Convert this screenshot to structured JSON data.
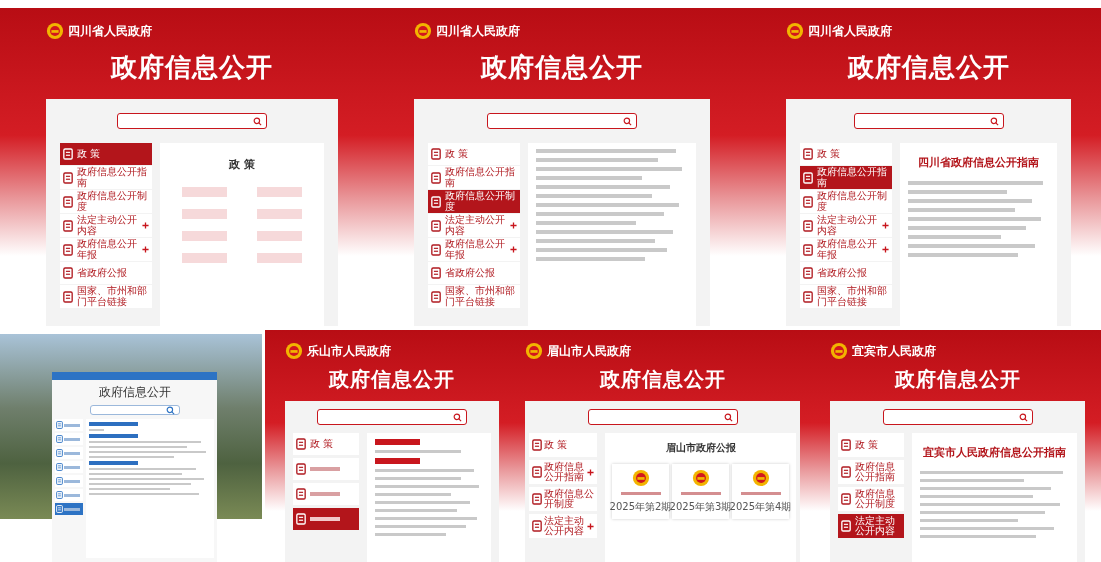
{
  "panels": [
    {
      "kind": "red",
      "logo": "四川省人民政府",
      "title": "政府信息公开",
      "nav": [
        {
          "label": "政 策",
          "selected": true,
          "expandable": false
        },
        {
          "label": "政府信息公开指南",
          "selected": false,
          "expandable": false
        },
        {
          "label": "政府信息公开制度",
          "selected": false,
          "expandable": false
        },
        {
          "label": "法定主动公开内容",
          "selected": false,
          "expandable": true
        },
        {
          "label": "政府信息公开年报",
          "selected": false,
          "expandable": true
        },
        {
          "label": "省政府公报",
          "selected": false,
          "expandable": false
        },
        {
          "label": "国家、市州和部门平台链接",
          "selected": false,
          "expandable": false
        }
      ],
      "content": {
        "kind": "chips",
        "heading": "政 策"
      }
    },
    {
      "kind": "red",
      "logo": "四川省人民政府",
      "title": "政府信息公开",
      "nav": [
        {
          "label": "政 策",
          "selected": false,
          "expandable": false
        },
        {
          "label": "政府信息公开指南",
          "selected": false,
          "expandable": false
        },
        {
          "label": "政府信息公开制度",
          "selected": true,
          "expandable": false
        },
        {
          "label": "法定主动公开内容",
          "selected": false,
          "expandable": true
        },
        {
          "label": "政府信息公开年报",
          "selected": false,
          "expandable": true
        },
        {
          "label": "省政府公报",
          "selected": false,
          "expandable": false
        },
        {
          "label": "国家、市州和部门平台链接",
          "selected": false,
          "expandable": false
        }
      ],
      "content": {
        "kind": "list"
      }
    },
    {
      "kind": "red",
      "logo": "四川省人民政府",
      "title": "政府信息公开",
      "nav": [
        {
          "label": "政 策",
          "selected": false,
          "expandable": false
        },
        {
          "label": "政府信息公开指南",
          "selected": true,
          "expandable": false
        },
        {
          "label": "政府信息公开制度",
          "selected": false,
          "expandable": false
        },
        {
          "label": "法定主动公开内容",
          "selected": false,
          "expandable": true
        },
        {
          "label": "政府信息公开年报",
          "selected": false,
          "expandable": true
        },
        {
          "label": "省政府公报",
          "selected": false,
          "expandable": false
        },
        {
          "label": "国家、市州和部门平台链接",
          "selected": false,
          "expandable": false
        }
      ],
      "content": {
        "kind": "article",
        "heading": "四川省政府信息公开指南"
      }
    },
    {
      "kind": "scenic",
      "title": "政府信息公开",
      "nav": [
        {
          "selected": false
        },
        {
          "selected": false
        },
        {
          "selected": false
        },
        {
          "selected": false
        },
        {
          "selected": false
        },
        {
          "selected": false
        },
        {
          "selected": true
        }
      ],
      "content": {
        "kind": "blue-list"
      }
    },
    {
      "kind": "red",
      "logo": "乐山市人民政府",
      "title": "政府信息公开",
      "nav": [
        {
          "label": "政 策",
          "selected": false,
          "expandable": false
        },
        {
          "selected": false
        },
        {
          "selected": false
        },
        {
          "selected": true
        }
      ],
      "content": {
        "kind": "dated-list"
      }
    },
    {
      "kind": "red",
      "logo": "眉山市人民政府",
      "title": "政府信息公开",
      "nav": [
        {
          "label": "政 策",
          "selected": false,
          "expandable": false
        },
        {
          "label": "政府信息公开指南",
          "selected": false,
          "expandable": true
        },
        {
          "label": "政府信息公开制度",
          "selected": false,
          "expandable": false
        },
        {
          "label": "法定主动公开内容",
          "selected": false,
          "expandable": true
        }
      ],
      "content": {
        "kind": "cards",
        "heading": "眉山市政府公报",
        "cards": [
          "2025年第2期",
          "2025年第3期",
          "2025年第4期"
        ]
      }
    },
    {
      "kind": "red",
      "logo": "宜宾市人民政府",
      "title": "政府信息公开",
      "nav": [
        {
          "label": "政 策",
          "selected": false,
          "expandable": false
        },
        {
          "label": "政府信息公开指南",
          "selected": false,
          "expandable": false
        },
        {
          "label": "政府信息公开制度",
          "selected": false,
          "expandable": false
        },
        {
          "label": "法定主动公开内容",
          "selected": true,
          "expandable": false
        }
      ],
      "content": {
        "kind": "article",
        "heading": "宜宾市人民政府信息公开指南"
      }
    }
  ]
}
